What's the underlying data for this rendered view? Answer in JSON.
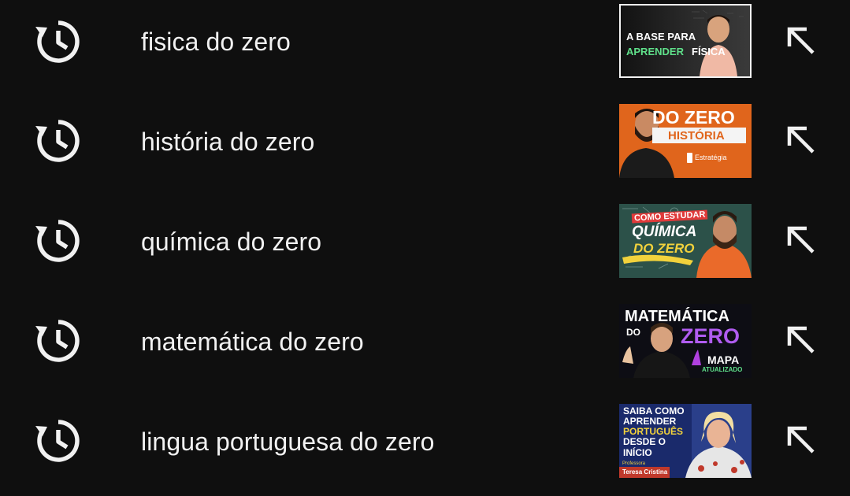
{
  "history": [
    {
      "query": "fisica do zero",
      "thumb": {
        "lines": [
          "A BASE PARA",
          "APRENDER",
          "FÍSICA"
        ]
      }
    },
    {
      "query": "história do zero",
      "thumb": {
        "lines": [
          "DO ZERO",
          "HISTÓRIA",
          "Estratégia"
        ]
      }
    },
    {
      "query": "química do zero",
      "thumb": {
        "lines": [
          "COMO ESTUDAR",
          "QUÍMICA",
          "DO ZERO"
        ]
      }
    },
    {
      "query": "matemática do zero",
      "thumb": {
        "lines": [
          "MATEMÁTICA",
          "DO",
          "ZERO",
          "MAPA",
          "ATUALIZADO"
        ]
      }
    },
    {
      "query": "lingua portuguesa do zero",
      "thumb": {
        "lines": [
          "SAIBA COMO",
          "APRENDER",
          "PORTUGUÊS",
          "DESDE O",
          "INÍCIO",
          "Professora",
          "Teresa Cristina"
        ]
      }
    }
  ],
  "icons": {
    "history": "history-icon",
    "fill": "arrow-up-left-icon"
  },
  "colors": {
    "background": "#0f0f0f",
    "text": "#f1f1f1"
  }
}
